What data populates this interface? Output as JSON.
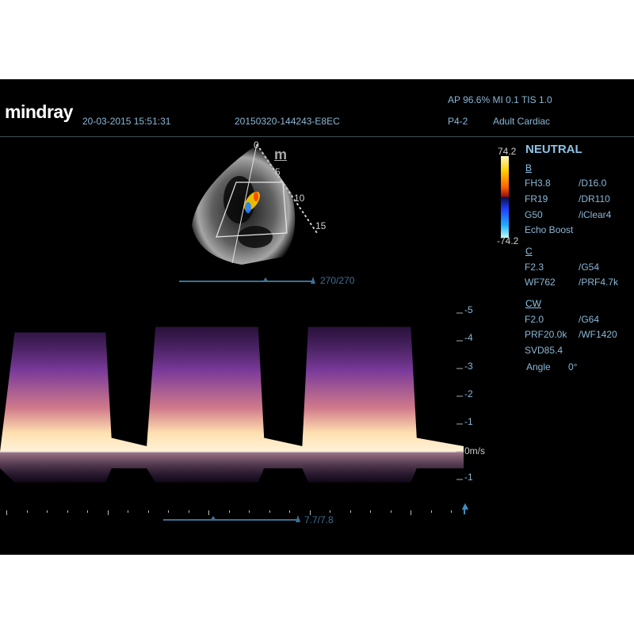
{
  "header": {
    "brand": "mindray",
    "datetime": "20-03-2015 15:51:31",
    "exam_id": "20150320-144243-E8EC",
    "power": "AP 96.6%  MI 0.1 TIS 1.0",
    "probe": "P4-2",
    "preset": "Adult Cardiac"
  },
  "colorbar": {
    "max": "74.2",
    "min": "-74.2"
  },
  "image_params": {
    "title": "NEUTRAL",
    "b": {
      "label": "B",
      "rows": [
        [
          "FH3.8",
          "/D16.0"
        ],
        [
          "FR19",
          "/DR110"
        ],
        [
          "G50",
          "/iClear4"
        ]
      ],
      "extra": "Echo Boost"
    },
    "c": {
      "label": "C",
      "rows": [
        [
          "F2.3",
          "/G54"
        ],
        [
          "WF762",
          "/PRF4.7k"
        ]
      ]
    },
    "cw": {
      "label": "CW",
      "rows": [
        [
          "F2.0",
          "/G64"
        ],
        [
          "PRF20.0k",
          "/WF1420"
        ]
      ],
      "extra": "SVD85.4",
      "angle_label": "Angle",
      "angle_value": "0°"
    }
  },
  "bmode": {
    "depth_marks": [
      "0",
      "5",
      "10",
      "15"
    ],
    "mark_logo": "m",
    "frame_counter": "270/270"
  },
  "doppler": {
    "velocity_unit": "0m/s",
    "scale_labels": [
      "-5",
      "-4",
      "-3",
      "-2",
      "-1",
      "0m/s",
      "-1"
    ],
    "time_counter": "7.7/7.8"
  },
  "colors": {
    "text": "#8ab7d6",
    "accent": "#8cc3e6",
    "scalebar": "#3d6f95"
  },
  "chart_data": {
    "type": "area",
    "title": "",
    "xlabel": "",
    "ylabel": "",
    "ylim": [
      -1.2,
      5.5
    ],
    "series": [
      {
        "x": [
          0,
          0.05,
          0.36,
          0.38,
          0.5,
          0.53,
          0.88,
          0.9,
          1.03,
          1.05,
          1.4,
          1.42,
          1.58
        ],
        "values": [
          0,
          4.3,
          4.3,
          0.5,
          0.2,
          4.5,
          4.5,
          0.5,
          0.2,
          4.5,
          4.5,
          0.5,
          0.2
        ]
      }
    ]
  }
}
